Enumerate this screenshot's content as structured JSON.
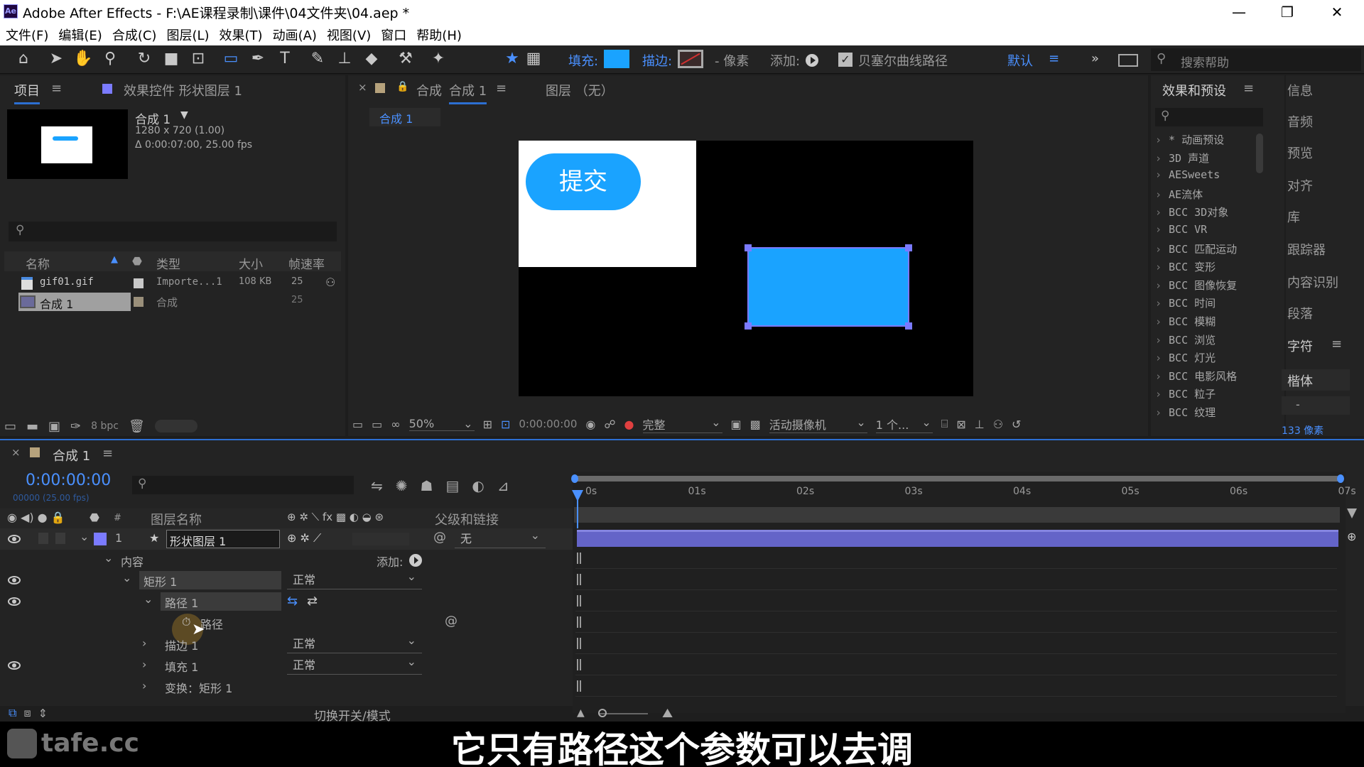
{
  "window": {
    "title": "Adobe After Effects - F:\\AE课程录制\\课件\\04文件夹\\04.aep *",
    "logo": "Ae",
    "controls": [
      "—",
      "❐",
      "✕"
    ]
  },
  "menu": [
    "文件(F)",
    "编辑(E)",
    "合成(C)",
    "图层(L)",
    "效果(T)",
    "动画(A)",
    "视图(V)",
    "窗口",
    "帮助(H)"
  ],
  "toolbar": {
    "fill_label": "填充:",
    "stroke_label": "描边:",
    "pixels_label": "- 像素",
    "add_label": "添加:",
    "bezier_label": "贝塞尔曲线路径",
    "default_label": "默认",
    "search_placeholder": "搜索帮助",
    "fill_color": "#1aa3ff",
    "stroke_color": "#d03030"
  },
  "project": {
    "tab": "项目",
    "effects_tab": "效果控件 形状图层 1",
    "comp_name": "合成 1",
    "comp_size": "1280 x 720 (1.00)",
    "comp_dur": "Δ 0:00:07:00, 25.00 fps",
    "columns": [
      "名称",
      "类型",
      "大小",
      "帧速率"
    ],
    "items": [
      {
        "name": "gif01.gif",
        "type": "Importe...1",
        "size": "108 KB",
        "fps": "25"
      },
      {
        "name": "合成 1",
        "type": "合成",
        "size": "",
        "fps": "25"
      }
    ],
    "bpc": "8 bpc"
  },
  "viewer": {
    "tab_prefix": "合成",
    "tab_name": "合成 1",
    "layer_tab": "图层 （无）",
    "subtab": "合成 1",
    "submit_text": "提交",
    "zoom": "50%",
    "time": "0:00:00:00",
    "quality": "完整",
    "camera": "活动摄像机",
    "views": "1 个..."
  },
  "effects": {
    "title": "效果和预设",
    "items": [
      "* 动画预设",
      "3D 声道",
      "AESweets",
      "AE流体",
      "BCC 3D对象",
      "BCC VR",
      "BCC 匹配运动",
      "BCC 变形",
      "BCC 图像恢复",
      "BCC 时间",
      "BCC 模糊",
      "BCC 浏览",
      "BCC 灯光",
      "BCC 电影风格",
      "BCC 粒子",
      "BCC 纹理"
    ]
  },
  "right_tabs": [
    "信息",
    "音频",
    "预览",
    "对齐",
    "库",
    "跟踪器",
    "内容识别",
    "段落",
    "字符"
  ],
  "char": {
    "font": "楷体",
    "style": "-",
    "size": "133 像素"
  },
  "timeline": {
    "tab": "合成 1",
    "timecode": "0:00:00:00",
    "frameinfo": "00000 (25.00 fps)",
    "col_layer": "图层名称",
    "col_parent": "父级和链接",
    "layer_num": "1",
    "layer_name": "形状图层 1",
    "parent": "无",
    "rows": {
      "content": "内容",
      "add": "添加:",
      "rect": "矩形 1",
      "rect_mode": "正常",
      "path1": "路径 1",
      "path": "路径",
      "stroke": "描边 1",
      "stroke_mode": "正常",
      "fill": "填充 1",
      "fill_mode": "正常",
      "transform": "变换：矩形 1"
    },
    "ticks": [
      "0s",
      "01s",
      "02s",
      "03s",
      "04s",
      "05s",
      "06s",
      "07s"
    ],
    "toggle": "切换开关/模式"
  },
  "subtitle": "它只有路径这个参数可以去调",
  "watermark": "tafe.cc"
}
